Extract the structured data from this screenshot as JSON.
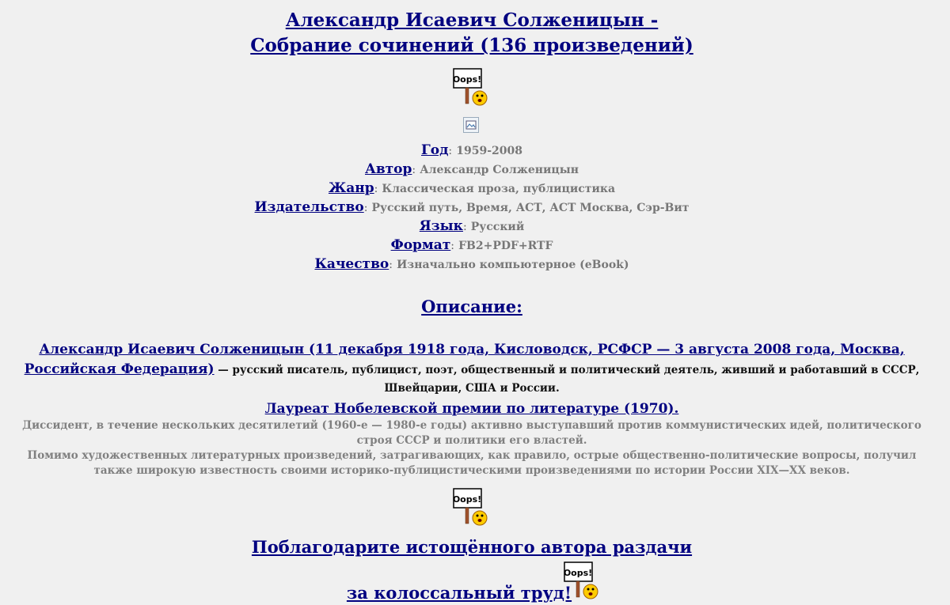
{
  "header": {
    "title_line1": "Александр Исаевич Солженицын -",
    "title_line2": "Собрание сочинений (136 произведений)"
  },
  "meta": [
    {
      "key": "Год",
      "value": "1959-2008"
    },
    {
      "key": "Автор",
      "value": "Александр Солженицын"
    },
    {
      "key": "Жанр",
      "value": "Классическая проза, публицистика"
    },
    {
      "key": "Издательство",
      "value": "Русский путь, Время, АСТ, АСТ Москва, Сэр-Вит"
    },
    {
      "key": "Язык",
      "value": "Русский"
    },
    {
      "key": "Формат",
      "value": "FB2+PDF+RTF"
    },
    {
      "key": "Качество",
      "value": "Изначально компьютерное (eBook)"
    }
  ],
  "separator": ":",
  "oops_label": "Oops!",
  "description": {
    "heading": "Описание:",
    "bio_link": "Александр Исаевич Солженицын (11 декабря 1918 года, Кисловодск, РСФСР — 3 августа 2008 года, Москва, Российская Федерация)",
    "bio_text": " — русский писатель, публицист, поэт, общественный и политический деятель, живший и работавший в СССР, Швейцарии, США и России.",
    "nobel_link": "Лауреат Нобелевской премии по литературе (1970).",
    "paragraph1": "Диссидент, в течение нескольких десятилетий (1960-е — 1980-е годы) активно выступавший против коммунистических идей, политического строя СССР и политики его властей.",
    "paragraph2": "Помимо художественных литературных произведений, затрагивающих, как правило, острые общественно-политические вопросы, получил также широкую известность своими историко-публицистическими произведениями по истории России XIX—XX веков."
  },
  "thanks": {
    "line1": "Поблагодарите истощённого автора раздачи",
    "line2": "за колоссальный труд!"
  },
  "colors": {
    "link": "#000080",
    "muted_text": "#808080",
    "background": "#f0f0f0"
  }
}
